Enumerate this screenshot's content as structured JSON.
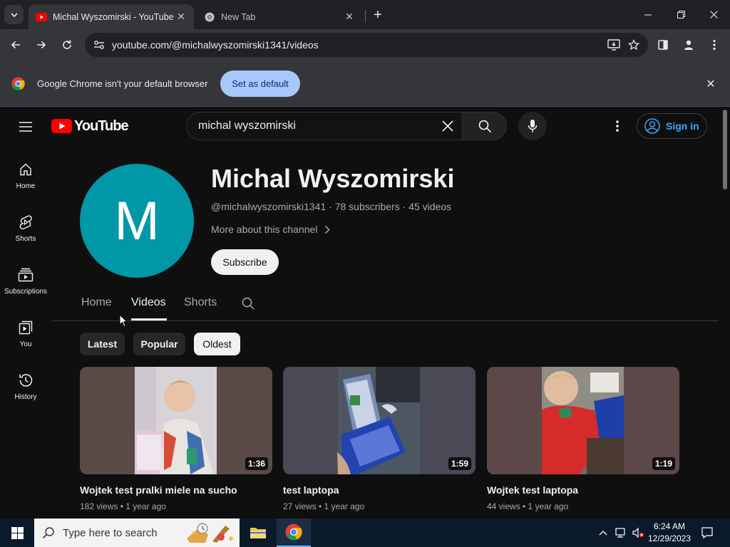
{
  "browser": {
    "tabs": [
      {
        "title": "Michal Wyszomirski - YouTube",
        "active": true
      },
      {
        "title": "New Tab",
        "active": false
      }
    ],
    "url": "youtube.com/@michalwyszomirski1341/videos",
    "infobar": {
      "message": "Google Chrome isn't your default browser",
      "button": "Set as default"
    }
  },
  "youtube": {
    "logo_text": "YouTube",
    "search_query": "michal wyszomirski",
    "sign_in": "Sign in",
    "guide": [
      {
        "label": "Home",
        "icon": "home-icon"
      },
      {
        "label": "Shorts",
        "icon": "shorts-icon"
      },
      {
        "label": "Subscriptions",
        "icon": "subscriptions-icon"
      },
      {
        "label": "You",
        "icon": "you-icon"
      },
      {
        "label": "History",
        "icon": "history-icon"
      }
    ],
    "channel": {
      "avatar_letter": "M",
      "avatar_color": "#0097a7",
      "name": "Michal Wyszomirski",
      "meta": "@michalwyszomirski1341 · 78 subscribers · 45 videos",
      "more": "More about this channel",
      "subscribe": "Subscribe"
    },
    "channel_tabs": [
      "Home",
      "Videos",
      "Shorts"
    ],
    "selected_tab": "Videos",
    "chips": [
      "Latest",
      "Popular",
      "Oldest"
    ],
    "selected_chip": "Oldest",
    "videos": [
      {
        "title": "Wojtek test pralki miele na sucho",
        "meta": "182 views • 1 year ago",
        "duration": "1:36"
      },
      {
        "title": "test laptopa",
        "meta": "27 views • 1 year ago",
        "duration": "1:59"
      },
      {
        "title": "Wojtek test laptopa",
        "meta": "44 views • 1 year ago",
        "duration": "1:19"
      }
    ]
  },
  "taskbar": {
    "search_placeholder": "Type here to search",
    "time": "6:24 AM",
    "date": "12/29/2023"
  }
}
